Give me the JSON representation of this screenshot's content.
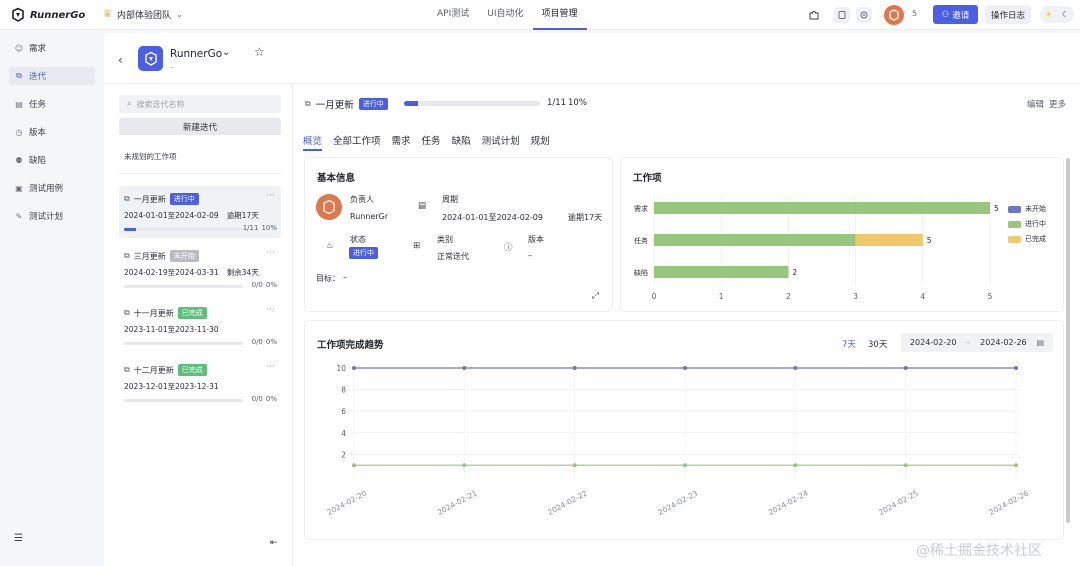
{
  "app": {
    "name": "RunnerGo",
    "team": "内部体验团队"
  },
  "topnav": {
    "tabs": [
      "API测试",
      "UI自动化",
      "项目管理"
    ],
    "active": "项目管理"
  },
  "header_actions": {
    "member_count": "5",
    "invite_label": "邀请",
    "log_label": "操作日志"
  },
  "leftnav": {
    "items": [
      {
        "label": "需求",
        "icon": "requirement-icon"
      },
      {
        "label": "迭代",
        "icon": "iteration-icon"
      },
      {
        "label": "任务",
        "icon": "task-icon"
      },
      {
        "label": "版本",
        "icon": "version-icon"
      },
      {
        "label": "缺陷",
        "icon": "bug-icon"
      },
      {
        "label": "测试用例",
        "icon": "testcase-icon"
      },
      {
        "label": "测试计划",
        "icon": "testplan-icon"
      }
    ],
    "active": "迭代"
  },
  "project": {
    "name": "RunnerGo",
    "subtitle": "–"
  },
  "iterations": {
    "search_placeholder": "搜索迭代名称",
    "new_button": "新建迭代",
    "unplanned": "未规划的工作项",
    "list": [
      {
        "name": "一月更新",
        "status": "进行中",
        "dates": "2024-01-01至2024-02-09",
        "extra": "逾期17天",
        "count": "1/11",
        "pct": "10%",
        "progress": 0.1
      },
      {
        "name": "三月更新",
        "status": "未开始",
        "dates": "2024-02-19至2024-03-31",
        "extra": "剩余34天",
        "count": "0/0",
        "pct": "0%",
        "progress": 0
      },
      {
        "name": "十一月更新",
        "status": "已完成",
        "dates": "2023-11-01至2023-11-30",
        "extra": "",
        "count": "0/0",
        "pct": "0%",
        "progress": 0
      },
      {
        "name": "十二月更新",
        "status": "已完成",
        "dates": "2023-12-01至2023-12-31",
        "extra": "",
        "count": "0/0",
        "pct": "0%",
        "progress": 0
      }
    ]
  },
  "current": {
    "name": "一月更新",
    "status": "进行中",
    "count": "1/11",
    "pct": "10%",
    "progress": 0.1,
    "edit_label": "编辑",
    "more_label": "更多"
  },
  "subtabs": [
    "概览",
    "全部工作项",
    "需求",
    "任务",
    "缺陷",
    "测试计划",
    "规划"
  ],
  "basic_info": {
    "title": "基本信息",
    "owner_label": "负责人",
    "owner_value": "RunnerGr",
    "period_label": "周期",
    "period_value": "2024-01-01至2024-02-09",
    "period_extra": "逾期17天",
    "status_label": "状态",
    "status_value": "进行中",
    "category_label": "类别",
    "category_value": "正常迭代",
    "version_label": "版本",
    "version_value": "–",
    "goal_label": "目标：",
    "goal_value": "–"
  },
  "workitems_title": "工作项",
  "trend": {
    "title": "工作项完成趋势",
    "range7": "7天",
    "range30": "30天",
    "date_from": "2024-02-20",
    "date_sep": "–",
    "date_to": "2024-02-26"
  },
  "colors": {
    "accent": "#4b5ee6",
    "todo": "#6b76c7",
    "in_progress": "#95c87a",
    "done": "#f0c96a"
  },
  "chart_data": [
    {
      "type": "bar",
      "orientation": "horizontal",
      "stacked": true,
      "title": "工作项",
      "categories": [
        "需求",
        "任务",
        "缺陷"
      ],
      "series": [
        {
          "name": "未开始",
          "values": [
            0,
            0,
            0
          ]
        },
        {
          "name": "进行中",
          "values": [
            5,
            3,
            2
          ]
        },
        {
          "name": "已完成",
          "values": [
            0,
            1,
            0
          ]
        }
      ],
      "totals": [
        5,
        5,
        2
      ],
      "xticks": [
        0,
        1,
        2,
        3,
        4,
        5
      ],
      "xlim": [
        0,
        5
      ],
      "legend": "right"
    },
    {
      "type": "line",
      "title": "工作项完成趋势",
      "x": [
        "2024-02-20",
        "2024-02-21",
        "2024-02-22",
        "2024-02-23",
        "2024-02-24",
        "2024-02-25",
        "2024-02-26"
      ],
      "series": [
        {
          "values": [
            10,
            10,
            10,
            10,
            10,
            10,
            10
          ]
        },
        {
          "values": [
            1,
            1,
            1,
            1,
            1,
            1,
            1
          ]
        }
      ],
      "yticks": [
        2,
        4,
        6,
        8,
        10
      ],
      "ylim": [
        0,
        10
      ],
      "grid": true
    }
  ],
  "watermark": "@稀土掘金技术社区"
}
